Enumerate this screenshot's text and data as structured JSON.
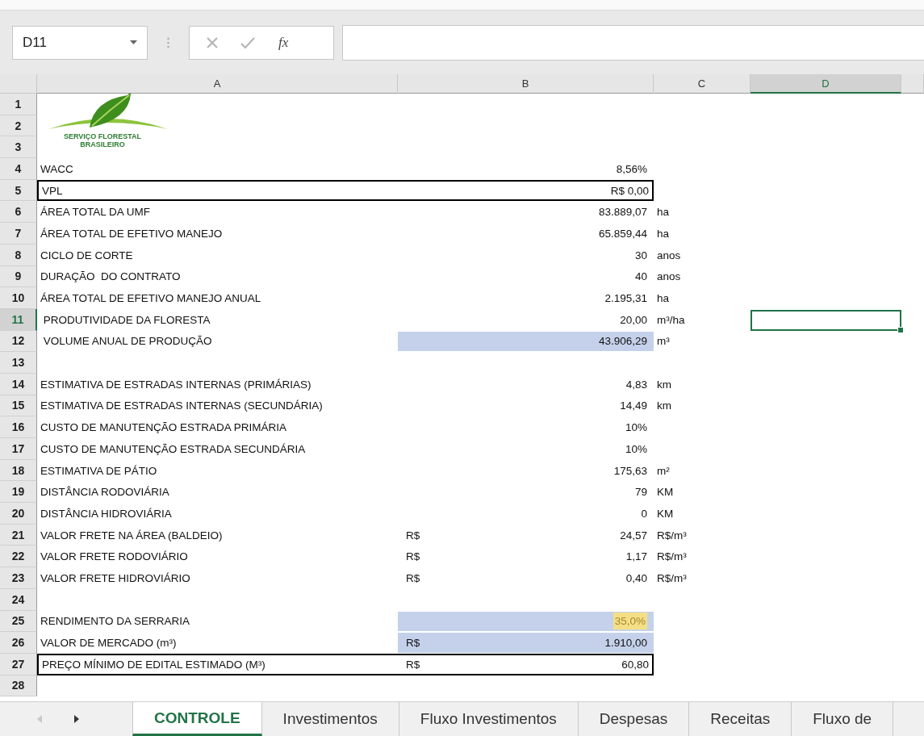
{
  "formula_bar": {
    "name_box": "D11",
    "function_label": "fx"
  },
  "logo": {
    "lines": [
      "SERVIÇO FLORESTAL",
      "BRASILEIRO"
    ]
  },
  "columns": [
    {
      "label": "A",
      "selected": false
    },
    {
      "label": "B",
      "selected": false
    },
    {
      "label": "C",
      "selected": false
    },
    {
      "label": "D",
      "selected": true
    }
  ],
  "rows": [
    {
      "number": "1",
      "selected": false
    },
    {
      "number": "2",
      "selected": false
    },
    {
      "number": "3",
      "selected": false
    },
    {
      "number": "4",
      "label": "WACC",
      "value": "8,56%",
      "selected": false
    },
    {
      "number": "5",
      "label": "VPL",
      "value": "R$ 0,00",
      "selected": false,
      "boxed": true
    },
    {
      "number": "6",
      "label": "ÁREA TOTAL DA UMF",
      "value": "83.889,07",
      "unit": "ha",
      "selected": false
    },
    {
      "number": "7",
      "label": "ÁREA TOTAL DE EFETIVO MANEJO",
      "value": "65.859,44",
      "unit": "ha",
      "selected": false
    },
    {
      "number": "8",
      "label": "CICLO DE CORTE",
      "value": "30",
      "unit": "anos",
      "selected": false
    },
    {
      "number": "9",
      "label": "DURAÇÃO  DO CONTRATO",
      "value": "40",
      "unit": "anos",
      "selected": false
    },
    {
      "number": "10",
      "label": "ÁREA TOTAL DE EFETIVO MANEJO ANUAL",
      "value": "2.195,31",
      "unit": "ha",
      "selected": false
    },
    {
      "number": "11",
      "label": " PRODUTIVIDADE DA FLORESTA",
      "value": "20,00",
      "unit": "m³/ha",
      "selected": true
    },
    {
      "number": "12",
      "label": " VOLUME ANUAL DE PRODUÇÃO",
      "value": "43.906,29",
      "unit": "m³",
      "selected": false,
      "shaded": true
    },
    {
      "number": "13",
      "selected": false
    },
    {
      "number": "14",
      "label": "ESTIMATIVA DE ESTRADAS INTERNAS (PRIMÁRIAS)",
      "value": "4,83",
      "unit": "km",
      "selected": false
    },
    {
      "number": "15",
      "label": "ESTIMATIVA DE ESTRADAS INTERNAS (SECUNDÁRIA)",
      "value": "14,49",
      "unit": "km",
      "selected": false
    },
    {
      "number": "16",
      "label": "CUSTO DE MANUTENÇÃO ESTRADA PRIMÁRIA",
      "value": "10%",
      "selected": false
    },
    {
      "number": "17",
      "label": "CUSTO DE MANUTENÇÃO ESTRADA SECUNDÁRIA",
      "value": "10%",
      "selected": false
    },
    {
      "number": "18",
      "label": "ESTIMATIVA DE PÁTIO",
      "value": "175,63",
      "unit": "m²",
      "selected": false
    },
    {
      "number": "19",
      "label": "DISTÂNCIA RODOVIÁRIA",
      "value": "79",
      "unit": "KM",
      "selected": false
    },
    {
      "number": "20",
      "label": "DISTÂNCIA HIDROVIÁRIA",
      "value": "0",
      "unit": "KM",
      "selected": false
    },
    {
      "number": "21",
      "label": "VALOR FRETE NA ÁREA (BALDEIO)",
      "currency": "R$",
      "value": "24,57",
      "unit": "R$/m³",
      "selected": false
    },
    {
      "number": "22",
      "label": "VALOR FRETE RODOVIÁRIO",
      "currency": "R$",
      "value": "1,17",
      "unit": "R$/m³",
      "selected": false
    },
    {
      "number": "23",
      "label": "VALOR FRETE HIDROVIÁRIO",
      "currency": "R$",
      "value": "0,40",
      "unit": "R$/m³",
      "selected": false
    },
    {
      "number": "24",
      "selected": false
    },
    {
      "number": "25",
      "label": "RENDIMENTO DA SERRARIA",
      "value": "35,0%",
      "selected": false,
      "shaded": true,
      "highlighted": true
    },
    {
      "number": "26",
      "label": "VALOR DE MERCADO (m³)",
      "currency": "R$",
      "value": "1.910,00",
      "selected": false,
      "shaded": true
    },
    {
      "number": "27",
      "label": "PREÇO MÍNIMO DE EDITAL ESTIMADO (M³)",
      "currency": "R$",
      "value": "60,80",
      "selected": false,
      "boxed": true
    },
    {
      "number": "28",
      "selected": false
    }
  ],
  "sheet_tabs": [
    {
      "label": "CONTROLE",
      "selected": true
    },
    {
      "label": "Investimentos",
      "selected": false
    },
    {
      "label": "Fluxo Investimentos",
      "selected": false
    },
    {
      "label": "Despesas",
      "selected": false
    },
    {
      "label": "Receitas",
      "selected": false
    },
    {
      "label": "Fluxo de",
      "selected": false
    }
  ]
}
